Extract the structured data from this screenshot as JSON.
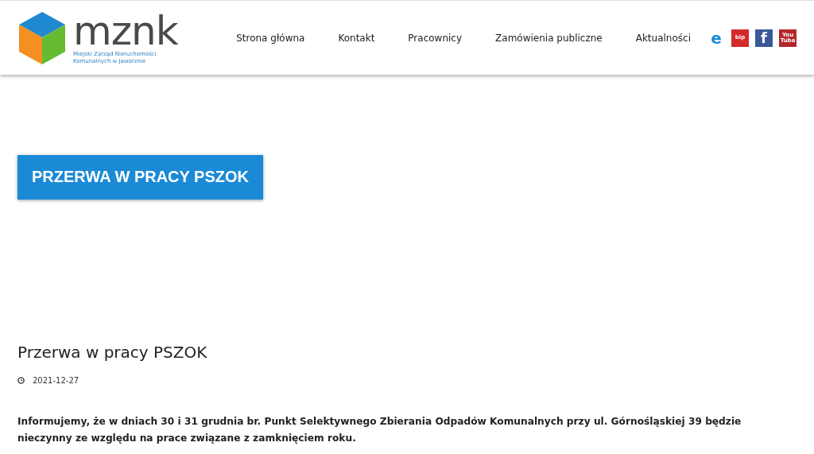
{
  "logo": {
    "wordmark": "mznk",
    "subtitle_lines": [
      "Miejski Zarząd Nieruchomości",
      "Komunalnych w Jaworznie"
    ]
  },
  "nav": [
    {
      "label": "Strona główna"
    },
    {
      "label": "Kontakt"
    },
    {
      "label": "Pracownicy"
    },
    {
      "label": "Zamówienia publiczne"
    },
    {
      "label": "Aktualności"
    }
  ],
  "social": [
    {
      "kind": "epuap",
      "text": "e"
    },
    {
      "kind": "bip",
      "text": "bip"
    },
    {
      "kind": "facebook",
      "text": "f"
    },
    {
      "kind": "youtube",
      "text": "You",
      "text2": "Tube"
    }
  ],
  "banner": {
    "title": "PRZERWA W PRACY PSZOK"
  },
  "article": {
    "title": "Przerwa w pracy PSZOK",
    "date": "2021-12-27",
    "body": "Informujemy, że w dniach 30 i 31 grudnia br. Punkt Selektywnego Zbierania Odpadów Komunalnych przy ul. Górnośląskiej 39 będzie nieczynny ze względu na prace związane z zamknięciem roku."
  }
}
